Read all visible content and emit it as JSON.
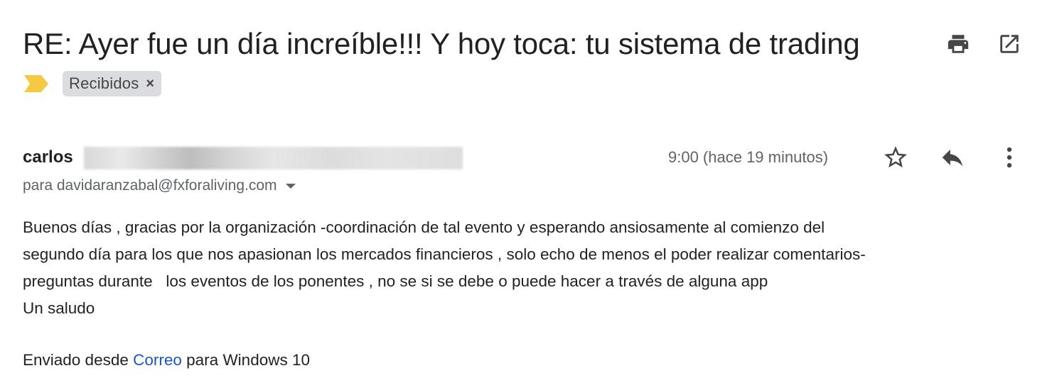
{
  "email": {
    "subject": "RE: Ayer fue un día increíble!!! Y hoy toca: tu sistema de trading",
    "labels": [
      {
        "text": "Recibidos",
        "remove_glyph": "×"
      }
    ],
    "sender": {
      "name": "carlos"
    },
    "timestamp": "9:00 (hace 19 minutos)",
    "recipient_line": "para davidaranzabal@fxforaliving.com",
    "body_lines": [
      "Buenos días , gracias por la organización -coordinación de tal evento y esperando ansiosamente al comienzo del",
      "segundo día para los que nos apasionan los mercados financieros , solo echo de menos el poder realizar comentarios-",
      "preguntas durante   los eventos de los ponentes , no se si se debe o puede hacer a través de alguna app",
      "Un saludo"
    ],
    "signature": {
      "prefix": "Enviado desde ",
      "link_text": "Correo",
      "suffix": " para Windows 10"
    }
  },
  "icons": {
    "importance": "importance-marker-icon",
    "print": "print-icon",
    "popout": "open-in-new-window-icon",
    "star": "star-icon",
    "reply": "reply-icon",
    "more": "more-vertical-icon",
    "recipient_details": "chevron-down-icon"
  },
  "colors": {
    "importance_marker": "#f6c945",
    "label_chip_bg": "#dadce0",
    "link": "#1a56c9",
    "icon": "#444746",
    "muted_text": "#5f6368"
  }
}
